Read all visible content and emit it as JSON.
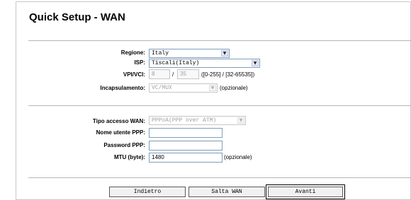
{
  "page": {
    "title": "Quick Setup - WAN"
  },
  "section1": {
    "region": {
      "label": "Regione:",
      "value": "Italy"
    },
    "isp": {
      "label": "ISP:",
      "value": "Tiscali(Italy)"
    },
    "vpivci": {
      "label": "VPI/VCI:",
      "vpi": "8",
      "separator": "/",
      "vci": "35",
      "range": "([0-255] / [32-65535])"
    },
    "encapsulation": {
      "label": "Incapsulamento:",
      "value": "VC/MUX",
      "note": "(opzionale)"
    }
  },
  "section2": {
    "wan_type": {
      "label": "Tipo accesso WAN:",
      "value": "PPPoA(PPP over ATM)"
    },
    "username": {
      "label": "Nome utente PPP:",
      "value": ""
    },
    "password": {
      "label": "Password PPP:",
      "value": ""
    },
    "mtu": {
      "label": "MTU (byte):",
      "value": "1480",
      "note": "(opzionale)"
    }
  },
  "buttons": {
    "back": "Indietro",
    "skip": "Salta WAN",
    "next": "Avanti"
  }
}
